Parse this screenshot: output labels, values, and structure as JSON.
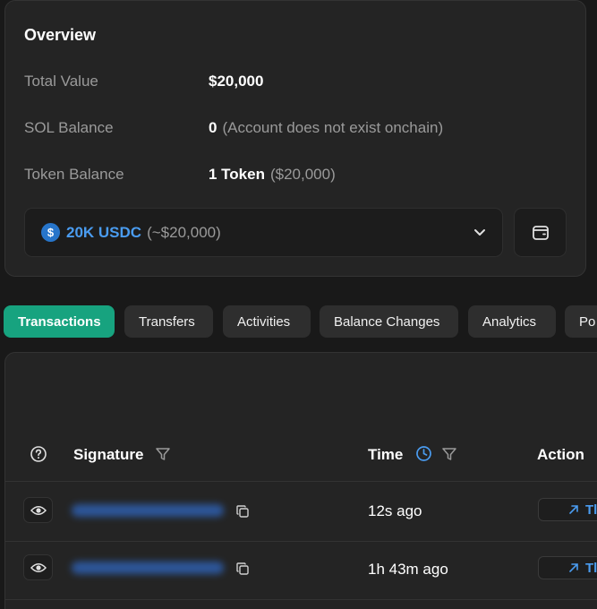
{
  "overview": {
    "title": "Overview",
    "rows": [
      {
        "label": "Total Value",
        "value": "$20,000",
        "extra": ""
      },
      {
        "label": "SOL Balance",
        "value": "0",
        "extra": "(Account does not exist onchain)"
      },
      {
        "label": "Token Balance",
        "value": "1 Token",
        "extra": "($20,000)"
      }
    ],
    "token_select": {
      "icon": "usdc-coin-icon",
      "amount": "20K USDC",
      "usd": "(~$20,000)"
    }
  },
  "tabs": [
    "Transactions",
    "Transfers",
    "Activities",
    "Balance Changes",
    "Analytics",
    "Po"
  ],
  "table": {
    "headers": {
      "signature": "Signature",
      "time": "Time",
      "action": "Action"
    },
    "rows": [
      {
        "time": "12s ago",
        "action": "Tl"
      },
      {
        "time": "1h 43m ago",
        "action": "Tl"
      }
    ]
  },
  "colors": {
    "accent": "#17a37f",
    "link": "#4a9cf0",
    "background": "#191919",
    "card": "#242424"
  }
}
